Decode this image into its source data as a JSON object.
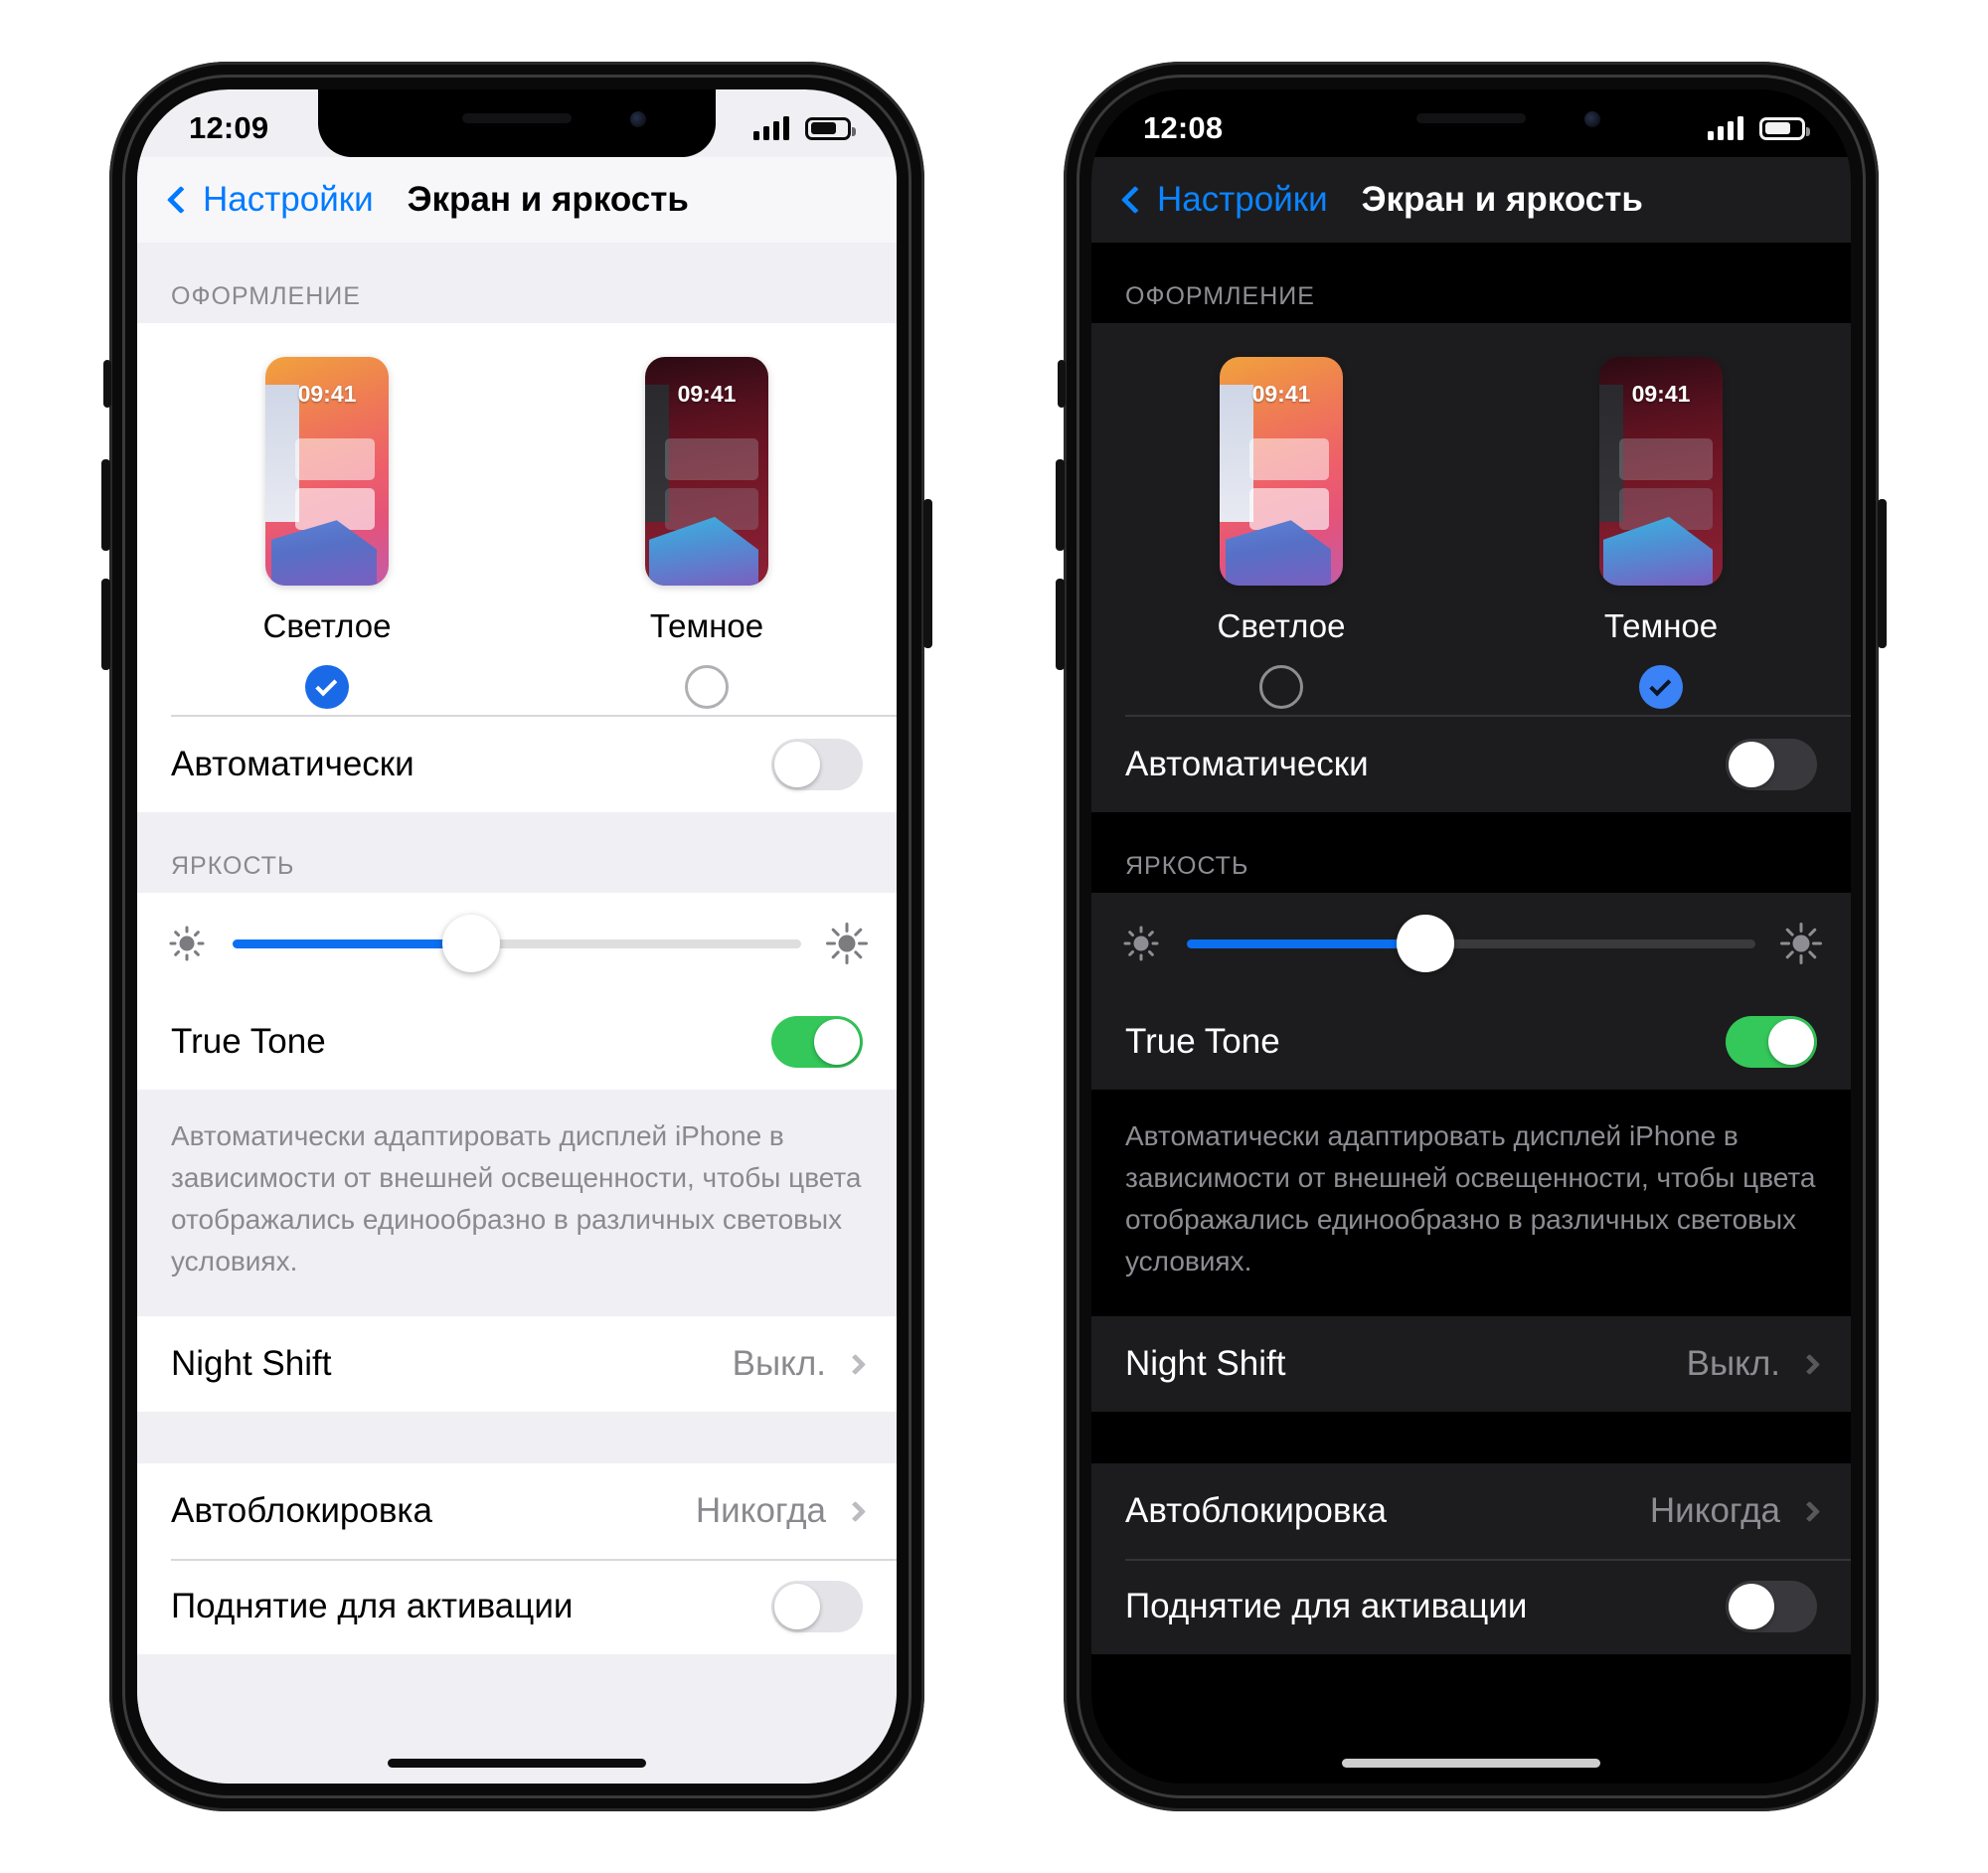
{
  "phones": [
    {
      "id": "light-mode-phone",
      "theme": "light",
      "status": {
        "time": "12:09",
        "signal_bars": 4,
        "battery_percent": 62
      },
      "nav": {
        "back_label": "Настройки",
        "title": "Экран и яркость"
      },
      "appearance": {
        "header": "ОФОРМЛЕНИЕ",
        "options": [
          {
            "label": "Светлое",
            "thumb_time": "09:41",
            "selected": true
          },
          {
            "label": "Темное",
            "thumb_time": "09:41",
            "selected": false
          }
        ],
        "auto_row": {
          "label": "Автоматически",
          "toggle_on": false
        }
      },
      "brightness": {
        "header": "ЯРКОСТЬ",
        "slider_percent": 42,
        "true_tone": {
          "label": "True Tone",
          "toggle_on": true
        },
        "note": "Автоматически адаптировать дисплей iPhone в зависимости от внешней освещенности, чтобы цвета отображались единообразно в различных световых условиях."
      },
      "night_shift": {
        "label": "Night Shift",
        "value": "Выкл."
      },
      "bottom_rows": [
        {
          "label": "Автоблокировка",
          "value": "Никогда",
          "type": "chevron"
        },
        {
          "label": "Поднятие для активации",
          "type": "toggle",
          "toggle_on": false
        }
      ]
    },
    {
      "id": "dark-mode-phone",
      "theme": "dark",
      "status": {
        "time": "12:08",
        "signal_bars": 4,
        "battery_percent": 62
      },
      "nav": {
        "back_label": "Настройки",
        "title": "Экран и яркость"
      },
      "appearance": {
        "header": "ОФОРМЛЕНИЕ",
        "options": [
          {
            "label": "Светлое",
            "thumb_time": "09:41",
            "selected": false
          },
          {
            "label": "Темное",
            "thumb_time": "09:41",
            "selected": true
          }
        ],
        "auto_row": {
          "label": "Автоматически",
          "toggle_on": false
        }
      },
      "brightness": {
        "header": "ЯРКОСТЬ",
        "slider_percent": 42,
        "true_tone": {
          "label": "True Tone",
          "toggle_on": true
        },
        "note": "Автоматически адаптировать дисплей iPhone в зависимости от внешней освещенности, чтобы цвета отображались единообразно в различных световых условиях."
      },
      "night_shift": {
        "label": "Night Shift",
        "value": "Выкл."
      },
      "bottom_rows": [
        {
          "label": "Автоблокировка",
          "value": "Никогда",
          "type": "chevron"
        },
        {
          "label": "Поднятие для активации",
          "type": "toggle",
          "toggle_on": false
        }
      ]
    }
  ],
  "colors": {
    "accent_blue": "#007aff",
    "accent_blue_dark": "#3b82f6",
    "toggle_green": "#34c759",
    "slider_blue": "#0a6ff0",
    "light_bg": "#efeff4",
    "dark_bg": "#000000",
    "dark_card": "#1c1c1e"
  }
}
